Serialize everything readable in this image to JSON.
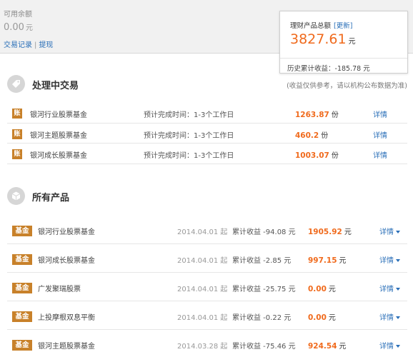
{
  "balance": {
    "label": "可用余额",
    "value": "0.00",
    "unit": "元"
  },
  "links": {
    "trade_record": "交易记录",
    "separator": "|",
    "withdraw": "提现"
  },
  "summary": {
    "title": "理财产品总额",
    "refresh": "[更新]",
    "amount": "3827.61",
    "unit": "元",
    "history_label": "历史累计收益：",
    "history_value": "-185.78 元"
  },
  "processing": {
    "title": "处理中交易",
    "note": "(收益仅供参考，请以机构公布数据为准)",
    "rows": [
      {
        "badge": "账",
        "name": "银河行业股票基金",
        "time": "预计完成时间：1-3个工作日",
        "amount": "1263.87",
        "unit": "份",
        "detail": "详情"
      },
      {
        "badge": "账",
        "name": "银河主题股票基金",
        "time": "预计完成时间：1-3个工作日",
        "amount": "460.2",
        "unit": "份",
        "detail": "详情"
      },
      {
        "badge": "账",
        "name": "银河成长股票基金",
        "time": "预计完成时间：1-3个工作日",
        "amount": "1003.07",
        "unit": "份",
        "detail": "详情"
      }
    ]
  },
  "products": {
    "title": "所有产品",
    "rows": [
      {
        "badge": "基金",
        "name": "银河行业股票基金",
        "date": "2014.04.01 起",
        "profit": "累计收益 -94.08 元",
        "amount": "1905.92",
        "unit": "元",
        "detail": "详情"
      },
      {
        "badge": "基金",
        "name": "银河成长股票基金",
        "date": "2014.04.01 起",
        "profit": "累计收益 -2.85 元",
        "amount": "997.15",
        "unit": "元",
        "detail": "详情"
      },
      {
        "badge": "基金",
        "name": "广发聚瑞股票",
        "date": "2014.04.01 起",
        "profit": "累计收益 -25.75 元",
        "amount": "0.00",
        "unit": "元",
        "detail": "详情"
      },
      {
        "badge": "基金",
        "name": "上投摩根双息平衡",
        "date": "2014.04.01 起",
        "profit": "累计收益 -0.22 元",
        "amount": "0.00",
        "unit": "元",
        "detail": "详情"
      },
      {
        "badge": "基金",
        "name": "银河主题股票基金",
        "date": "2014.03.28 起",
        "profit": "累计收益 -75.46 元",
        "amount": "924.54",
        "unit": "元",
        "detail": "详情"
      }
    ]
  },
  "colors": {
    "accent": "#f06a1c",
    "link": "#2a6fb8",
    "badge": "#c8812a"
  },
  "icons": {
    "processing": "tag-icon",
    "products": "box-icon",
    "detail_dropdown": "caret-down-icon"
  }
}
